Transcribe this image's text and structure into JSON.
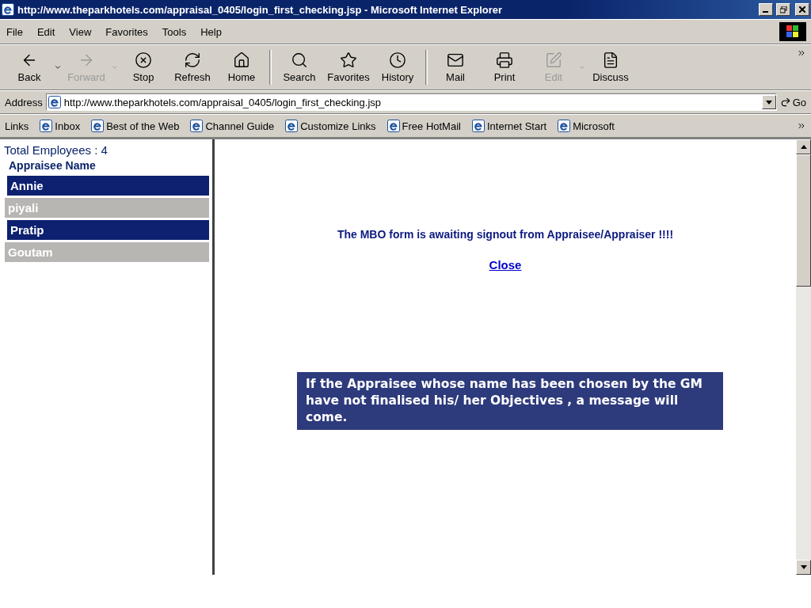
{
  "window": {
    "title": "http://www.theparkhotels.com/appraisal_0405/login_first_checking.jsp - Microsoft Internet Explorer"
  },
  "menu": [
    {
      "label": "File"
    },
    {
      "label": "Edit"
    },
    {
      "label": "View"
    },
    {
      "label": "Favorites"
    },
    {
      "label": "Tools"
    },
    {
      "label": "Help"
    }
  ],
  "toolbar": [
    {
      "kind": "back",
      "label": "Back",
      "disabled": false,
      "dropdown": true
    },
    {
      "kind": "forward",
      "label": "Forward",
      "disabled": true,
      "dropdown": true
    },
    {
      "kind": "stop",
      "label": "Stop",
      "disabled": false,
      "dropdown": false
    },
    {
      "kind": "refresh",
      "label": "Refresh",
      "disabled": false,
      "dropdown": false
    },
    {
      "kind": "home",
      "label": "Home",
      "disabled": false,
      "dropdown": false,
      "separator_after": true
    },
    {
      "kind": "search",
      "label": "Search",
      "disabled": false,
      "dropdown": false
    },
    {
      "kind": "favorites",
      "label": "Favorites",
      "disabled": false,
      "dropdown": false
    },
    {
      "kind": "history",
      "label": "History",
      "disabled": false,
      "dropdown": false,
      "separator_after": true
    },
    {
      "kind": "mail",
      "label": "Mail",
      "disabled": false,
      "dropdown": false
    },
    {
      "kind": "print",
      "label": "Print",
      "disabled": false,
      "dropdown": false
    },
    {
      "kind": "edit",
      "label": "Edit",
      "disabled": true,
      "dropdown": true
    },
    {
      "kind": "discuss",
      "label": "Discuss",
      "disabled": false,
      "dropdown": false
    }
  ],
  "address_bar": {
    "label": "Address",
    "url": "http://www.theparkhotels.com/appraisal_0405/login_first_checking.jsp",
    "go": "Go"
  },
  "links_bar": {
    "label": "Links",
    "links": [
      "Inbox",
      "Best of the Web",
      "Channel Guide",
      "Customize Links",
      "Free HotMail",
      "Internet Start",
      "Microsoft"
    ]
  },
  "left_frame": {
    "total": "Total Employees : 4",
    "heading": "Appraisee Name",
    "employees": [
      "Annie",
      "piyali",
      "Pratip",
      "Goutam"
    ]
  },
  "main_frame": {
    "message": "The MBO form is awaiting signout from Appraisee/Appraiser !!!!",
    "close_link": "Close"
  },
  "callout": {
    "text": "If the Appraisee whose name has been chosen by the GM have not finalised his/ her Objectives , a message will come."
  }
}
